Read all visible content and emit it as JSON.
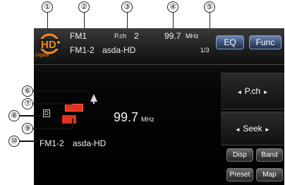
{
  "callouts": [
    "①",
    "②",
    "③",
    "④",
    "⑤",
    "⑥",
    "⑦",
    "⑧",
    "⑨",
    "⑩"
  ],
  "top": {
    "band": "FM1",
    "pch_label": "P.ch",
    "pch_value": "2",
    "freq": "99.7",
    "freq_unit": "MHz",
    "station": "FM1-2",
    "station_name": "asda-HD",
    "page": "1/3",
    "logo_sub": "Digital"
  },
  "buttons": {
    "eq": "EQ",
    "func": "Func",
    "pch": "P.ch",
    "seek": "Seek",
    "disp": "Disp",
    "band": "Band",
    "preset": "Preset",
    "map": "Map",
    "arrow_left": "◄",
    "arrow_right": "►"
  },
  "main": {
    "freq": "99.7",
    "freq_unit": "MHz",
    "station": "FM1-2",
    "station_name": "asda-HD",
    "hd_indicator": "D"
  },
  "colors": {
    "accent_orange": "#f08a1c",
    "red_indicator": "#e0321e",
    "button_blue": "#3c5078"
  },
  "icons": [
    "hd-radio-logo-icon",
    "signal-strength-icon",
    "hd-indicator-icon",
    "red-status-icon"
  ]
}
